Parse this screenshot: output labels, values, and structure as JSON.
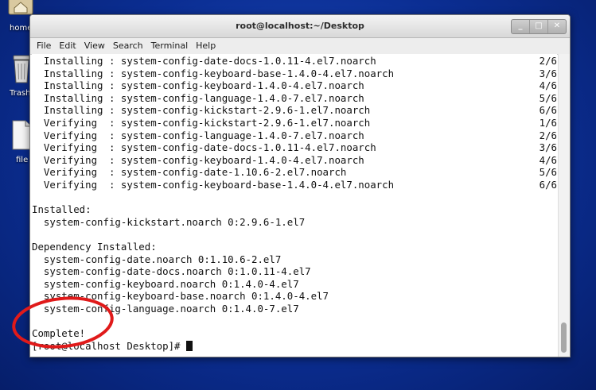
{
  "desktop": {
    "icons": [
      {
        "label": "home",
        "icon": "home-folder-icon"
      },
      {
        "label": "Trash",
        "icon": "trash-icon"
      },
      {
        "label": "file",
        "icon": "file-icon"
      }
    ]
  },
  "window": {
    "title": "root@localhost:~/Desktop",
    "controls": {
      "minimize": "_",
      "maximize": "□",
      "close": "✕"
    }
  },
  "menu": [
    "File",
    "Edit",
    "View",
    "Search",
    "Terminal",
    "Help"
  ],
  "terminal": {
    "lines": [
      {
        "text": "  Installing : system-config-date-docs-1.0.11-4.el7.noarch",
        "right": "2/6"
      },
      {
        "text": "  Installing : system-config-keyboard-base-1.4.0-4.el7.noarch",
        "right": "3/6"
      },
      {
        "text": "  Installing : system-config-keyboard-1.4.0-4.el7.noarch",
        "right": "4/6"
      },
      {
        "text": "  Installing : system-config-language-1.4.0-7.el7.noarch",
        "right": "5/6"
      },
      {
        "text": "  Installing : system-config-kickstart-2.9.6-1.el7.noarch",
        "right": "6/6"
      },
      {
        "text": "  Verifying  : system-config-kickstart-2.9.6-1.el7.noarch",
        "right": "1/6"
      },
      {
        "text": "  Verifying  : system-config-language-1.4.0-7.el7.noarch",
        "right": "2/6"
      },
      {
        "text": "  Verifying  : system-config-date-docs-1.0.11-4.el7.noarch",
        "right": "3/6"
      },
      {
        "text": "  Verifying  : system-config-keyboard-1.4.0-4.el7.noarch",
        "right": "4/6"
      },
      {
        "text": "  Verifying  : system-config-date-1.10.6-2.el7.noarch",
        "right": "5/6"
      },
      {
        "text": "  Verifying  : system-config-keyboard-base-1.4.0-4.el7.noarch",
        "right": "6/6"
      },
      {
        "text": "",
        "right": ""
      },
      {
        "text": "Installed:",
        "right": ""
      },
      {
        "text": "  system-config-kickstart.noarch 0:2.9.6-1.el7",
        "right": ""
      },
      {
        "text": "",
        "right": ""
      },
      {
        "text": "Dependency Installed:",
        "right": ""
      },
      {
        "text": "  system-config-date.noarch 0:1.10.6-2.el7",
        "right": ""
      },
      {
        "text": "  system-config-date-docs.noarch 0:1.0.11-4.el7",
        "right": ""
      },
      {
        "text": "  system-config-keyboard.noarch 0:1.4.0-4.el7",
        "right": ""
      },
      {
        "text": "  system-config-keyboard-base.noarch 0:1.4.0-4.el7",
        "right": ""
      },
      {
        "text": "  system-config-language.noarch 0:1.4.0-7.el7",
        "right": ""
      },
      {
        "text": "",
        "right": ""
      },
      {
        "text": "Complete!",
        "right": ""
      }
    ],
    "prompt": "[root@localhost Desktop]# "
  },
  "colors": {
    "desktop_bg": "#1f4fc4",
    "annotation": "#e01a1a",
    "terminal_fg": "#111111",
    "terminal_bg": "#ffffff"
  }
}
